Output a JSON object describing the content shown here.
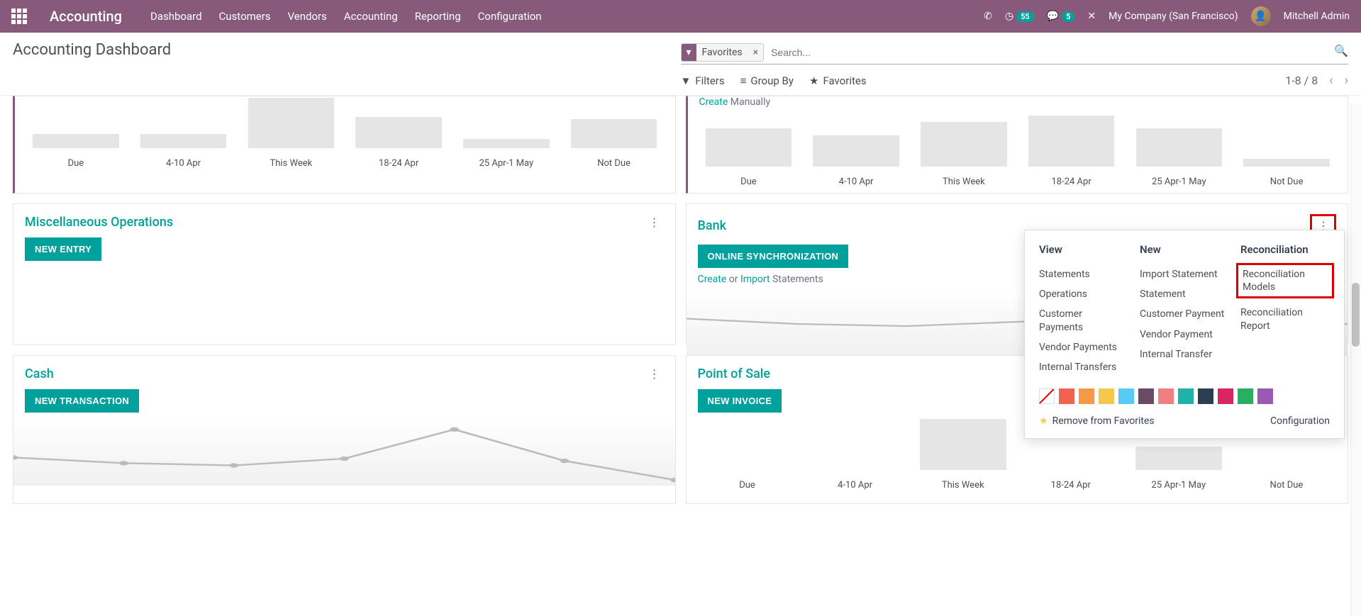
{
  "nav": {
    "app_title": "Accounting",
    "links": [
      "Dashboard",
      "Customers",
      "Vendors",
      "Accounting",
      "Reporting",
      "Configuration"
    ],
    "badge_activities": "55",
    "badge_messages": "5",
    "company": "My Company (San Francisco)",
    "user": "Mitchell Admin"
  },
  "page": {
    "title": "Accounting Dashboard",
    "search_facet": "Favorites",
    "search_placeholder": "Search...",
    "pager": "1-8 / 8"
  },
  "controls": {
    "filters": "Filters",
    "groupby": "Group By",
    "favorites": "Favorites"
  },
  "chart_labels": [
    "Due",
    "4-10 Apr",
    "This Week",
    "18-24 Apr",
    "25 Apr-1 May",
    "Not Due"
  ],
  "cards": {
    "create_manually_prefix": "Create",
    "create_manually_suffix": "Manually",
    "misc": {
      "title": "Miscellaneous Operations",
      "btn": "NEW ENTRY"
    },
    "bank": {
      "title": "Bank",
      "btn": "ONLINE SYNCHRONIZATION",
      "create": "Create",
      "or": "or",
      "import": "Import",
      "statements": "Statements"
    },
    "cash": {
      "title": "Cash",
      "btn": "NEW TRANSACTION"
    },
    "pos": {
      "title": "Point of Sale",
      "btn": "NEW INVOICE"
    }
  },
  "popover": {
    "view_h": "View",
    "new_h": "New",
    "recon_h": "Reconciliation",
    "view_items": [
      "Statements",
      "Operations",
      "Customer Payments",
      "Vendor Payments",
      "Internal Transfers"
    ],
    "new_items": [
      "Import Statement",
      "Statement",
      "Customer Payment",
      "Vendor Payment",
      "Internal Transfer"
    ],
    "recon_items": [
      "Reconciliation Models",
      "Reconciliation Report"
    ],
    "palette": [
      "#ef6351",
      "#f2994a",
      "#f2c94c",
      "#56ccf2",
      "#6b4a63",
      "#f08080",
      "#20b2aa",
      "#2c3e50",
      "#d72660",
      "#27ae60",
      "#9b59b6"
    ],
    "remove_fav": "Remove from Favorites",
    "config": "Configuration"
  },
  "chart_data": [
    {
      "type": "bar",
      "card": "top-left-partial",
      "categories": [
        "Due",
        "4-10 Apr",
        "This Week",
        "18-24 Apr",
        "25 Apr-1 May",
        "Not Due"
      ],
      "values": [
        18,
        18,
        65,
        40,
        12,
        38
      ],
      "ylim": [
        0,
        100
      ],
      "xlabel": "",
      "ylabel": ""
    },
    {
      "type": "bar",
      "card": "top-right-partial",
      "categories": [
        "Due",
        "4-10 Apr",
        "This Week",
        "18-24 Apr",
        "25 Apr-1 May",
        "Not Due"
      ],
      "values": [
        50,
        40,
        58,
        70,
        50,
        10
      ],
      "ylim": [
        0,
        100
      ],
      "xlabel": "",
      "ylabel": ""
    },
    {
      "type": "bar",
      "card": "point-of-sale",
      "categories": [
        "Due",
        "4-10 Apr",
        "This Week",
        "18-24 Apr",
        "25 Apr-1 May",
        "Not Due"
      ],
      "values": [
        0,
        0,
        70,
        0,
        30,
        0
      ],
      "ylim": [
        0,
        100
      ],
      "xlabel": "",
      "ylabel": ""
    },
    {
      "type": "line",
      "card": "cash",
      "x": [
        0,
        1,
        2,
        3,
        4,
        5,
        6
      ],
      "y": [
        25,
        20,
        18,
        24,
        50,
        22,
        5
      ],
      "ylim": [
        0,
        60
      ],
      "xlabel": "",
      "ylabel": ""
    },
    {
      "type": "line",
      "card": "bank",
      "x": [
        0,
        1,
        2,
        3,
        4,
        5,
        6
      ],
      "y": [
        22,
        18,
        16,
        20,
        24,
        20,
        19
      ],
      "ylim": [
        0,
        40
      ],
      "xlabel": "",
      "ylabel": ""
    }
  ]
}
